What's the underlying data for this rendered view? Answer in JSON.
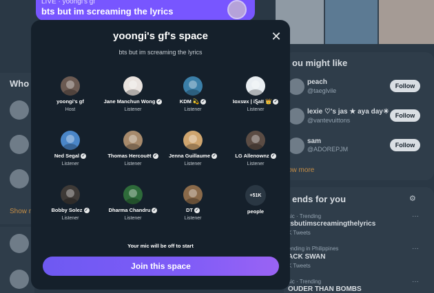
{
  "background": {
    "live_meta": "LIVE · yoongi's gf",
    "live_title": "bts but im screaming the lyrics",
    "who_to_follow_title": "Who t",
    "show_more_left": "Show m",
    "you_might_like_title": "ou might like",
    "suggestions": [
      {
        "name": "peach",
        "handle": "@taeglvile",
        "follow_label": "Follow"
      },
      {
        "name": "lexie ♡'s jas ★ aya day☀",
        "handle": "@vantevuittons",
        "follow_label": "Follow"
      },
      {
        "name": "sam",
        "handle": "@ADOREPJM",
        "follow_label": "Follow"
      }
    ],
    "show_more_right": "ow more",
    "trends_title": "ends for you",
    "trends": [
      {
        "meta": "sic · Trending",
        "name": "tsbutimscreamingthelyrics",
        "count": "K Tweets"
      },
      {
        "meta": "ending in Philippines",
        "name": "ACK SWAN",
        "count": "K Tweets"
      },
      {
        "meta": "sic · Trending",
        "name": "OUDER THAN BOMBS",
        "count": ""
      }
    ]
  },
  "modal": {
    "title": "yoongi's gf's space",
    "subtitle": "bts but im screaming the lyrics",
    "close_icon": "close-icon",
    "participants": [
      {
        "name": "yoongi's gf",
        "role": "Host",
        "verified": false,
        "emoji": "",
        "avatar_color": "#6b5a52"
      },
      {
        "name": "Jane Manchun Wong",
        "role": "Listener",
        "verified": true,
        "emoji": "",
        "avatar_color": "#e9e3df"
      },
      {
        "name": "KDM",
        "role": "Listener",
        "verified": true,
        "emoji": "💫",
        "avatar_color": "#3b7fa8"
      },
      {
        "name": "ʇoxsɐx | iⱾaII",
        "role": "Listener",
        "verified": true,
        "emoji": "👑",
        "avatar_color": "#e9eef2"
      },
      {
        "name": "Ned Segal",
        "role": "Listener",
        "verified": true,
        "emoji": "",
        "avatar_color": "#4a86c8"
      },
      {
        "name": "Thomas Hercouët",
        "role": "Listener",
        "verified": true,
        "emoji": "",
        "avatar_color": "#a78a6c"
      },
      {
        "name": "Jenna Guillaume",
        "role": "Listener",
        "verified": true,
        "emoji": "",
        "avatar_color": "#cfa56f"
      },
      {
        "name": "LG Allenownz",
        "role": "Listener",
        "verified": true,
        "emoji": "",
        "avatar_color": "#5b4c44"
      },
      {
        "name": "Bobby Solez",
        "role": "Listener",
        "verified": true,
        "emoji": "",
        "avatar_color": "#3e3a37"
      },
      {
        "name": "Dharma Chandru",
        "role": "Listener",
        "verified": true,
        "emoji": "",
        "avatar_color": "#2e6b3a"
      },
      {
        "name": "DT",
        "role": "Listener",
        "verified": true,
        "emoji": "",
        "avatar_color": "#8a6a4a"
      }
    ],
    "more_count": "+51K",
    "more_label": "people",
    "mic_note": "Your mic will be off to start",
    "join_label": "Join this space"
  }
}
